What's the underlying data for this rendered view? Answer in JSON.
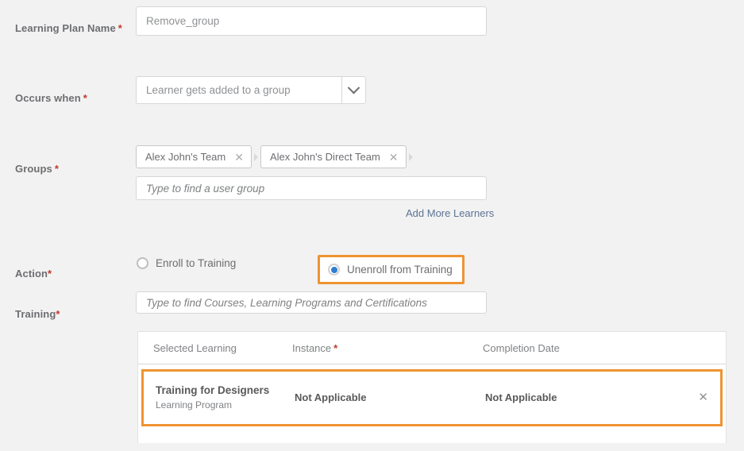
{
  "form": {
    "learning_plan_name": {
      "label": "Learning Plan Name",
      "required_mark": "*",
      "value": "Remove_group"
    },
    "occurs_when": {
      "label": "Occurs when",
      "required_mark": "*",
      "selected": "Learner gets added to a group",
      "chevron_icon": "chevron-down-icon"
    },
    "groups": {
      "label": "Groups",
      "required_mark": "*",
      "chips": [
        {
          "label": "Alex John's Team",
          "remove_icon": "close-icon"
        },
        {
          "label": "Alex John's Direct Team",
          "remove_icon": "close-icon"
        }
      ],
      "search_placeholder": "Type to find a user group",
      "add_more_link": "Add More Learners"
    },
    "action": {
      "label": "Action",
      "required_mark": "*",
      "options": [
        {
          "label": "Enroll to Training",
          "selected": false,
          "highlighted": false
        },
        {
          "label": "Unenroll from Training",
          "selected": true,
          "highlighted": true
        }
      ]
    },
    "training": {
      "label": "Training",
      "required_mark": "*",
      "search_placeholder": "Type to find Courses, Learning Programs and Certifications"
    }
  },
  "training_table": {
    "columns": {
      "selected_learning": "Selected Learning",
      "instance": "Instance",
      "instance_required_mark": "*",
      "completion_date": "Completion Date"
    },
    "rows": [
      {
        "title": "Training for Designers",
        "subtitle": "Learning Program",
        "instance": "Not Applicable",
        "completion_date": "Not Applicable",
        "remove_icon": "close-icon",
        "highlighted": true
      }
    ]
  },
  "colors": {
    "highlight": "#ef9331",
    "required": "#c0392b",
    "link": "#5d7494",
    "radio_selected": "#2f7ed1",
    "page_background": "#f2f2f2"
  }
}
